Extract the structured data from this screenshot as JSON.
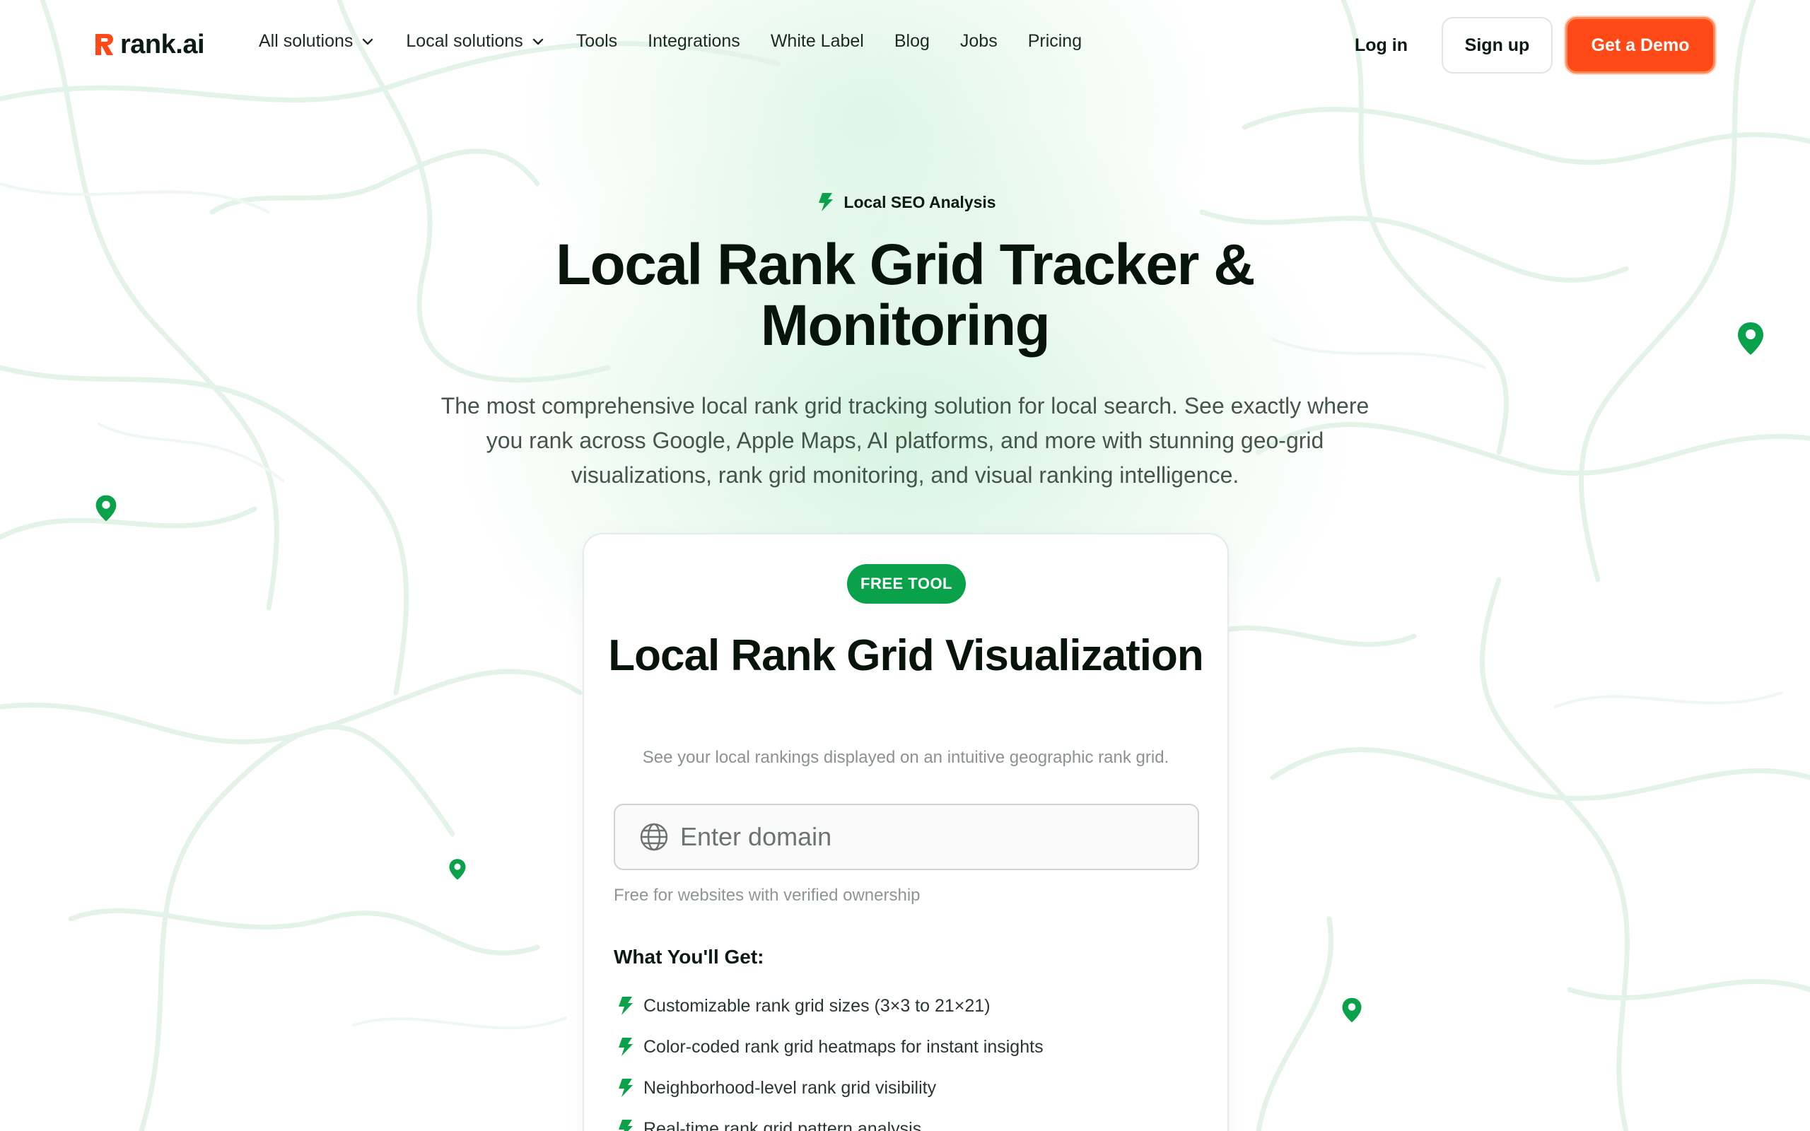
{
  "brand": {
    "logo_text": "rank.ai",
    "accent": "#ff4a17",
    "green": "#0aa14b"
  },
  "nav": {
    "items": [
      {
        "label": "All solutions",
        "has_dropdown": true
      },
      {
        "label": "Local solutions",
        "has_dropdown": true
      },
      {
        "label": "Tools",
        "has_dropdown": false
      },
      {
        "label": "Integrations",
        "has_dropdown": false
      },
      {
        "label": "White Label",
        "has_dropdown": false
      },
      {
        "label": "Blog",
        "has_dropdown": false
      },
      {
        "label": "Jobs",
        "has_dropdown": false
      },
      {
        "label": "Pricing",
        "has_dropdown": false
      }
    ],
    "login": "Log in",
    "signup": "Sign up",
    "demo": "Get a Demo"
  },
  "hero": {
    "eyebrow": "Local SEO Analysis",
    "title": "Local Rank Grid Tracker & Monitoring",
    "subtitle": "The most comprehensive local rank grid tracking solution for local search. See exactly where you rank across Google, Apple Maps, AI platforms, and more with stunning geo-grid visualizations, rank grid monitoring, and visual ranking intelligence."
  },
  "tool_card": {
    "badge": "FREE TOOL",
    "title": "Local Rank Grid Visualization",
    "subtitle": "See your local rankings displayed on an intuitive geographic rank grid.",
    "domain_placeholder": "Enter domain",
    "domain_value": "",
    "hint": "Free for websites with verified ownership",
    "features_title": "What You'll Get:",
    "features": [
      "Customizable rank grid sizes (3×3 to 21×21)",
      "Color-coded rank grid heatmaps for instant insights",
      "Neighborhood-level rank grid visibility",
      "Real-time rank grid pattern analysis"
    ]
  },
  "icons": {
    "bolt": "lightning-bolt-icon",
    "pin": "map-pin-icon",
    "globe": "globe-icon",
    "chevron": "chevron-down-icon"
  }
}
